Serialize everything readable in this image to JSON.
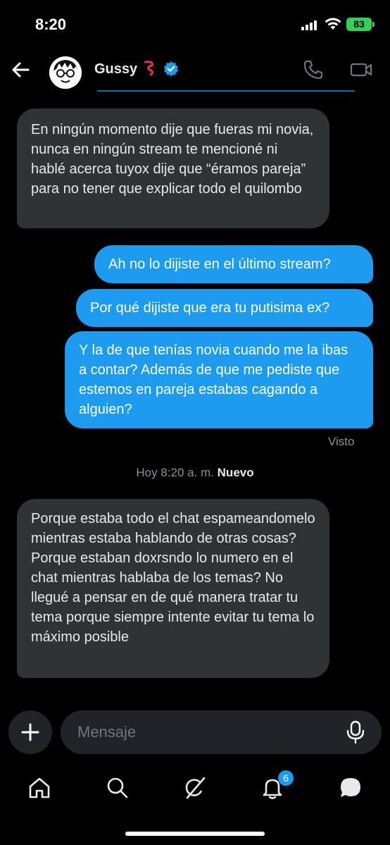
{
  "status": {
    "time": "8:20",
    "battery": "83"
  },
  "header": {
    "contact_name": "Gussy"
  },
  "messages": [
    {
      "direction": "in",
      "text": "En ningún momento dije que fueras mi novia, nunca en ningún stream te mencioné ni hablé acerca tuyox dije que “éramos pareja” para no tener que explicar todo el quilombo"
    },
    {
      "direction": "out",
      "text": "Ah no lo dijiste en el último stream?"
    },
    {
      "direction": "out",
      "text": "Por qué dijiste que era tu putisima ex?"
    },
    {
      "direction": "out",
      "text": "Y la de que tenías novia cuando me la ibas a contar? Además de que me pediste que estemos en pareja estabas cagando a alguien?"
    },
    {
      "direction": "in",
      "text": "Porque estaba todo el chat espameandomelo mientras estaba hablando de otras cosas? Porque estaban doxrsndo lo numero en el chat mientras hablaba de los temas? No llegué a pensar en de qué manera tratar tu tema porque siempre intente evitar tu tema lo máximo posible"
    }
  ],
  "seen_label": "Visto",
  "divider": {
    "time": "Hoy 8:20 a. m.",
    "new_label": "Nuevo"
  },
  "composer": {
    "placeholder": "Mensaje"
  },
  "nav": {
    "notification_count": "6",
    "items": [
      "home-icon",
      "search-icon",
      "grok-icon",
      "notifications-icon",
      "messages-icon"
    ]
  },
  "colors": {
    "accent": "#1d9bf0",
    "incoming_bubble": "#2f3336",
    "background": "#000000",
    "battery": "#30d158"
  }
}
